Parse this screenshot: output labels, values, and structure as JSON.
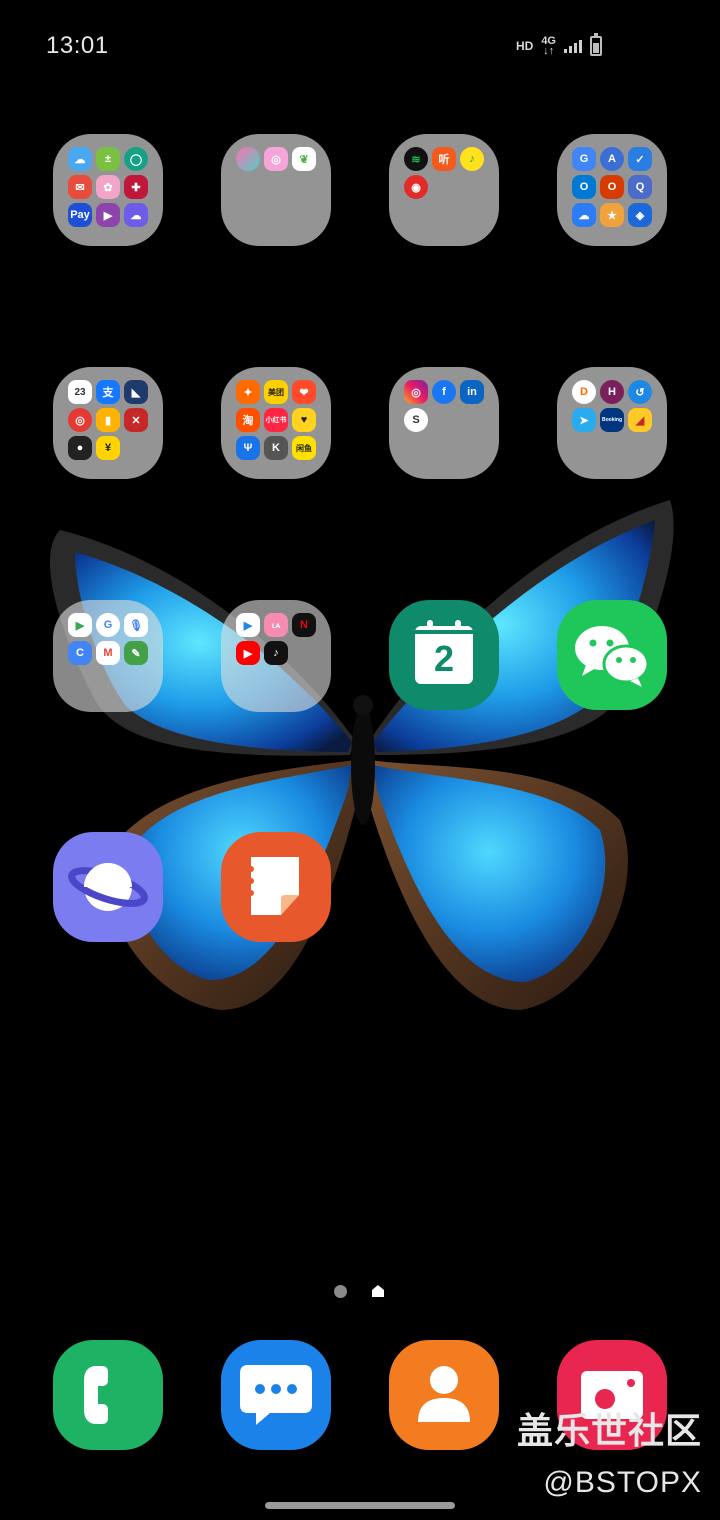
{
  "status_bar": {
    "time": "13:01",
    "hd_label": "HD",
    "network_label": "4G",
    "signal_bars": 4
  },
  "watermark": {
    "line1": "盖乐世社区",
    "line2": "@BSTOPX"
  },
  "home_screen": {
    "current_page_is_home": true,
    "folders": [
      {
        "name": "folder-1",
        "apps": [
          "weather-icon",
          "calculator-icon",
          "security-icon",
          "email-icon",
          "gallery-icon",
          "game-launcher-icon",
          "samsung-pay-icon",
          "video-player-icon",
          "cloud-icon"
        ],
        "labels": {
          "samsung-pay-icon": "Pay"
        }
      },
      {
        "name": "folder-2",
        "apps": [
          "camera-icon",
          "bixby-icon",
          "snapseed-icon"
        ],
        "labels": {}
      },
      {
        "name": "folder-3",
        "apps": [
          "spotify-icon",
          "ting-icon",
          "music-icon",
          "netease-music-icon"
        ],
        "labels": {
          "ting-icon": "听"
        }
      },
      {
        "name": "folder-4",
        "apps": [
          "google-translate-icon",
          "dictionary-icon",
          "search-app-icon",
          "outlook-icon",
          "office-icon",
          "q-icon",
          "baidu-cloud-icon",
          "app-icon",
          "vpn-icon"
        ],
        "labels": {}
      },
      {
        "name": "folder-5",
        "apps": [
          "calendar-icon",
          "alipay-icon",
          "cat-icon",
          "app-icon",
          "app-icon",
          "app-icon",
          "panda-icon",
          "yuan-icon"
        ],
        "labels": {
          "calendar-icon": "23",
          "alipay-icon": "支",
          "yuan-icon": "¥"
        }
      },
      {
        "name": "folder-6",
        "apps": [
          "app-icon",
          "meituan-icon",
          "app-icon",
          "taobao-icon",
          "xiaohongshu-icon",
          "map-icon",
          "deer-icon",
          "k-icon",
          "xianyu-icon"
        ],
        "labels": {
          "meituan-icon": "美团",
          "taobao-icon": "淘",
          "xiaohongshu-icon": "小红书",
          "k-icon": "K",
          "xianyu-icon": "闲鱼"
        }
      },
      {
        "name": "folder-7",
        "apps": [
          "instagram-icon",
          "facebook-icon",
          "linkedin-icon",
          "app-icon"
        ],
        "labels": {
          "facebook-icon": "f",
          "linkedin-icon": "in"
        }
      },
      {
        "name": "folder-8",
        "apps": [
          "didi-icon",
          "huazhu-icon",
          "app-icon",
          "telegram-icon",
          "booking-icon",
          "app-icon"
        ],
        "labels": {
          "huazhu-icon": "H",
          "booking-icon": "Booking"
        }
      },
      {
        "name": "folder-9",
        "apps": [
          "play-store-icon",
          "google-icon",
          "microphone-icon",
          "google-contacts-icon",
          "gmail-icon",
          "app-icon"
        ],
        "labels": {
          "google-icon": "G",
          "gmail-icon": "M"
        }
      },
      {
        "name": "folder-10",
        "apps": [
          "tencent-video-icon",
          "bilibili-icon",
          "netflix-icon",
          "youtube-icon",
          "tiktok-icon"
        ],
        "labels": {
          "netflix-icon": "N"
        }
      }
    ],
    "apps": [
      {
        "name": "calendar-app",
        "label": "2"
      },
      {
        "name": "wechat-app"
      },
      {
        "name": "internet-browser-app"
      },
      {
        "name": "notes-app"
      }
    ],
    "dock": [
      "phone-app",
      "messages-app",
      "contacts-app",
      "screen-recorder-app"
    ]
  },
  "colors": {
    "folder_bg": "#bebebe",
    "calendar_green": "#0f8a6b",
    "wechat_green": "#1fc75b",
    "browser_purple": "#7a7cf0",
    "notes_orange": "#e7592c",
    "phone_green": "#1db264",
    "messages_blue": "#1a82e8",
    "contacts_orange": "#f47c20",
    "recorder_red": "#e8264f"
  }
}
